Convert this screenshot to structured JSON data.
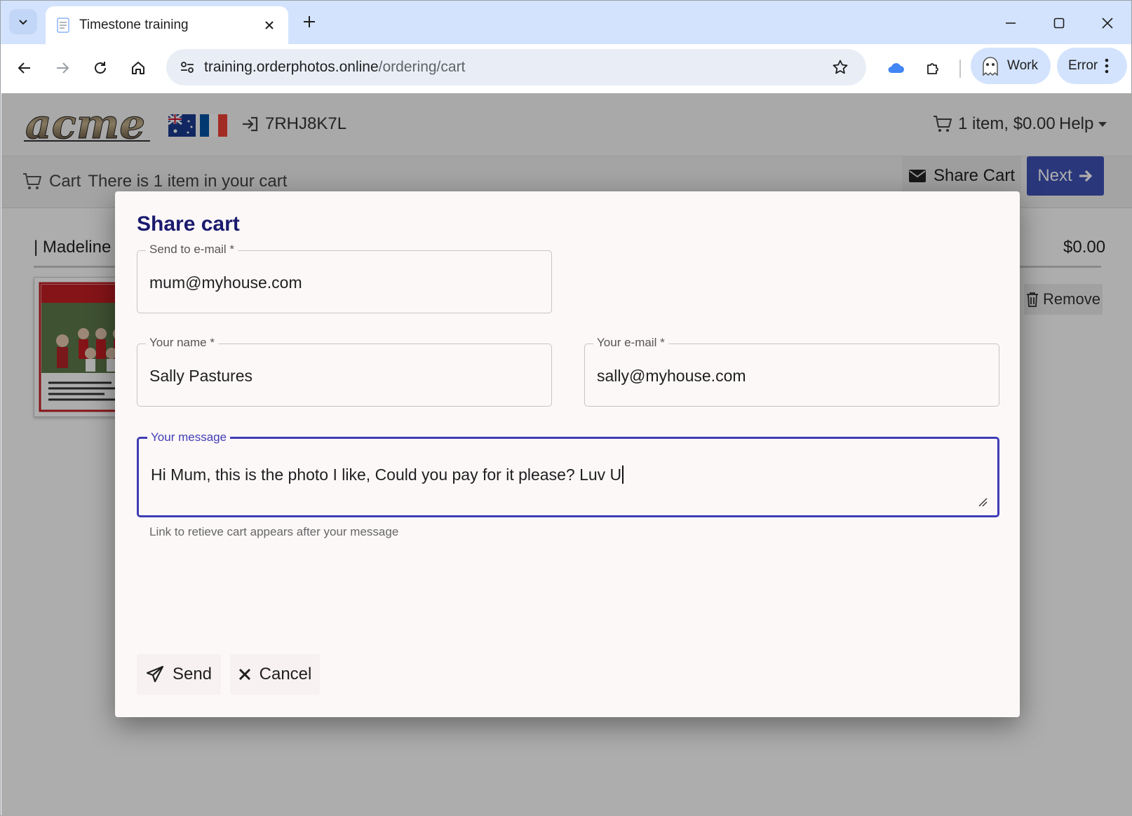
{
  "browser": {
    "tab_title": "Timestone training",
    "url_host": "training.orderphotos.online",
    "url_path": "/ordering/cart",
    "profile_label": "Work",
    "error_label": "Error"
  },
  "header": {
    "logo_text": "acme",
    "session_code": "7RHJ8K7L",
    "cart_summary": "1 item, $0.00",
    "help_label": "Help"
  },
  "cart_bar": {
    "cart_label": "Cart",
    "cart_message": "There is 1 item in your cart",
    "share_cart_label": "Share Cart",
    "next_label": "Next"
  },
  "cart_item": {
    "title": "| Madeline M",
    "price": "$0.00",
    "remove_label": "Remove"
  },
  "dialog": {
    "title": "Share cart",
    "send_to": {
      "label": "Send to e-mail *",
      "value": "mum@myhouse.com"
    },
    "your_name": {
      "label": "Your name *",
      "value": "Sally Pastures"
    },
    "your_email": {
      "label": "Your e-mail *",
      "value": "sally@myhouse.com"
    },
    "message": {
      "label": "Your message",
      "value": "Hi Mum, this is the photo I like, Could you pay for it please? Luv U"
    },
    "hint": "Link to retieve cart appears after your message",
    "send_label": "Send",
    "cancel_label": "Cancel"
  },
  "colors": {
    "accent": "#3f51b5",
    "dialog_title": "#1a1a6e",
    "focus_border": "#3f3db5"
  }
}
